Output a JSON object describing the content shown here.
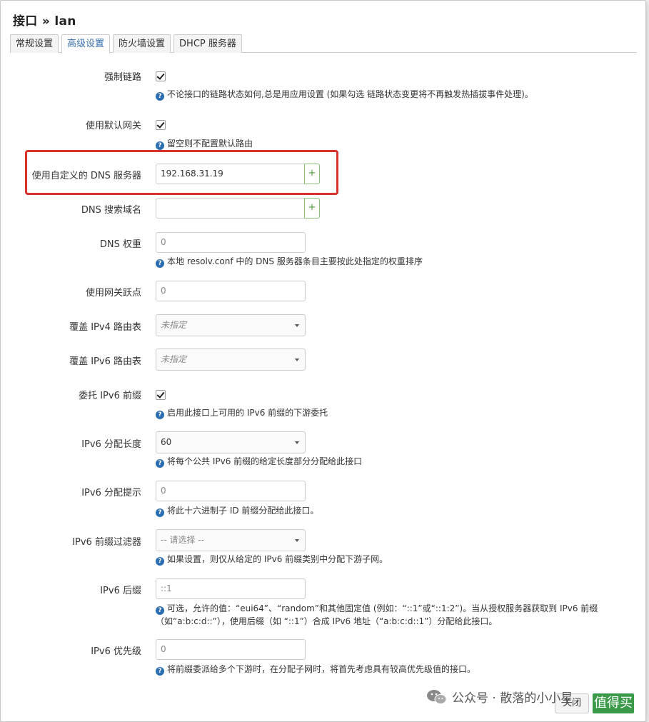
{
  "title": "接口 » lan",
  "tabs": [
    {
      "label": "常规设置",
      "active": false
    },
    {
      "label": "高级设置",
      "active": true
    },
    {
      "label": "防火墙设置",
      "active": false
    },
    {
      "label": "DHCP 服务器",
      "active": false
    }
  ],
  "fields": {
    "force_link": {
      "label": "强制链路",
      "checked": true,
      "help": "不论接口的链路状态如何,总是用应用设置 (如果勾选 链路状态变更将不再触发热插拔事件处理)。"
    },
    "default_gw": {
      "label": "使用默认网关",
      "checked": true,
      "help": "留空则不配置默认路由"
    },
    "custom_dns": {
      "label": "使用自定义的 DNS 服务器",
      "value": "192.168.31.19",
      "add": "+"
    },
    "dns_search": {
      "label": "DNS 搜索域名",
      "value": "",
      "add": "+"
    },
    "dns_weight": {
      "label": "DNS 权重",
      "value": "0",
      "help": "本地 resolv.conf 中的 DNS 服务器条目主要按此处指定的权重排序"
    },
    "gw_metric": {
      "label": "使用网关跃点",
      "value": "0"
    },
    "ipv4_table": {
      "label": "覆盖 IPv4 路由表",
      "value": "未指定"
    },
    "ipv6_table": {
      "label": "覆盖 IPv6 路由表",
      "value": "未指定"
    },
    "delegate": {
      "label": "委托 IPv6 前缀",
      "checked": true,
      "help": "启用此接口上可用的 IPv6 前缀的下游委托"
    },
    "ip6assign": {
      "label": "IPv6 分配长度",
      "value": "60",
      "help": "将每个公共 IPv6 前缀的给定长度部分分配给此接口"
    },
    "ip6hint": {
      "label": "IPv6 分配提示",
      "value": "0",
      "help": "将此十六进制子 ID 前缀分配给此接口。"
    },
    "ip6class": {
      "label": "IPv6 前缀过滤器",
      "value": "-- 请选择 --",
      "help": "如果设置，则仅从给定的 IPv6 前缀类别中分配下游子网。"
    },
    "ip6ifaceid": {
      "label": "IPv6 后缀",
      "value": "::1",
      "help": "可选，允许的值：“eui64”、“random”和其他固定值 (例如：“::1”或“::1:2”)。当从授权服务器获取到 IPv6 前缀（如“a:b:c:d::”），使用后缀（如 “::1”）合成 IPv6 地址（“a:b:c:d::1”）分配给此接口。"
    },
    "ip6weight": {
      "label": "IPv6 优先级",
      "value": "0",
      "help": "将前缀委派给多个下游时，在分配子网时，将首先考虑具有较高优先级值的接口。"
    }
  },
  "footer": {
    "wechat": "公众号 · 散落的小小星",
    "close": "关闭",
    "brand": "值得买"
  },
  "colors": {
    "highlight": "#d9312b",
    "accent": "#3a6fa8",
    "help_icon": "#2a6db0",
    "add_btn": "#4a9a3a"
  },
  "icons": {
    "help": "question-circle-icon",
    "wechat": "wechat-icon",
    "add": "plus-icon",
    "caret": "caret-down-icon"
  }
}
